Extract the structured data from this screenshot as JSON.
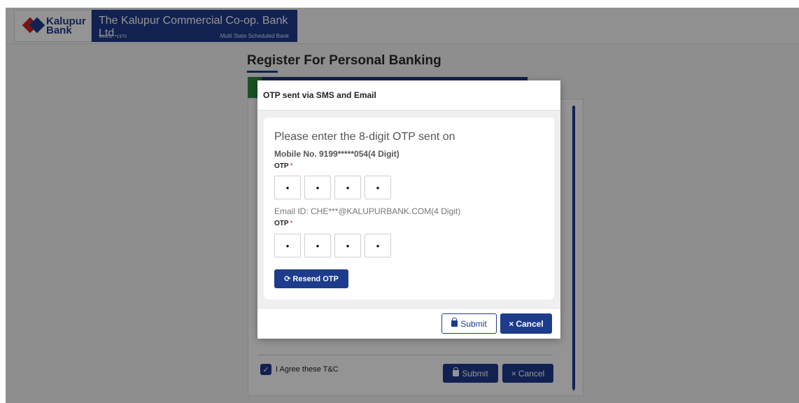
{
  "header": {
    "logo_text_line1": "Kalupur",
    "logo_text_line2": "Bank",
    "bank_name": "The Kalupur Commercial Co-op. Bank Ltd.",
    "since": "SINCE : 1970",
    "tagline": "Multi State Scheduled Bank",
    "brand_color": "#1e3c8c",
    "logo_red": "#d62226"
  },
  "page": {
    "title": "Register For Personal Banking",
    "agree_label": "I Agree these T&C",
    "submit_label": "Submit",
    "cancel_label": "Cancel"
  },
  "modal": {
    "title": "OTP sent via SMS and Email",
    "heading": "Please enter the 8-digit OTP sent on",
    "mobile_line": "Mobile No. 9199*****054(4 Digit)",
    "otp_label": "OTP",
    "required_mark": "*",
    "mobile_otp": [
      "•",
      "•",
      "•",
      "•"
    ],
    "email_line": "Email ID: CHE***@KALUPURBANK.COM(4 Digit)",
    "email_otp": [
      "•",
      "•",
      "•",
      "•"
    ],
    "resend_label": "Resend OTP",
    "submit_label": "Submit",
    "cancel_label": "Cancel"
  },
  "icons": {
    "resend": "refresh-icon",
    "submit": "lock-icon",
    "cancel": "close-icon",
    "checkbox": "check-icon",
    "resend_glyph": "⟳",
    "cancel_glyph": "×",
    "check_glyph": "✓",
    "scroll_up_glyph": "▲",
    "scroll_down_glyph": "▼"
  }
}
